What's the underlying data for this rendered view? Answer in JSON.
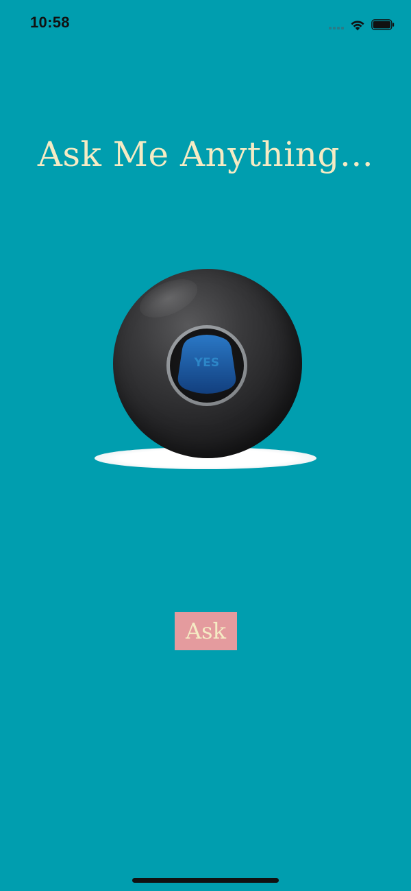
{
  "colors": {
    "background": "#009EAF",
    "title_text": "#F5EBC4",
    "button_background": "#E49B9E",
    "button_text": "#F5EBC4",
    "status_text": "#111111",
    "ball_answer_blue": "#1F5FA6"
  },
  "status_bar": {
    "time": "10:58",
    "icons": [
      "cellular-signal-icon",
      "wifi-icon",
      "battery-icon"
    ]
  },
  "main": {
    "title": "Ask Me Anything..."
  },
  "ball": {
    "image_name": "magic-8-ball-icon",
    "answer_text": "YES"
  },
  "actions": {
    "ask_button_label": "Ask"
  }
}
